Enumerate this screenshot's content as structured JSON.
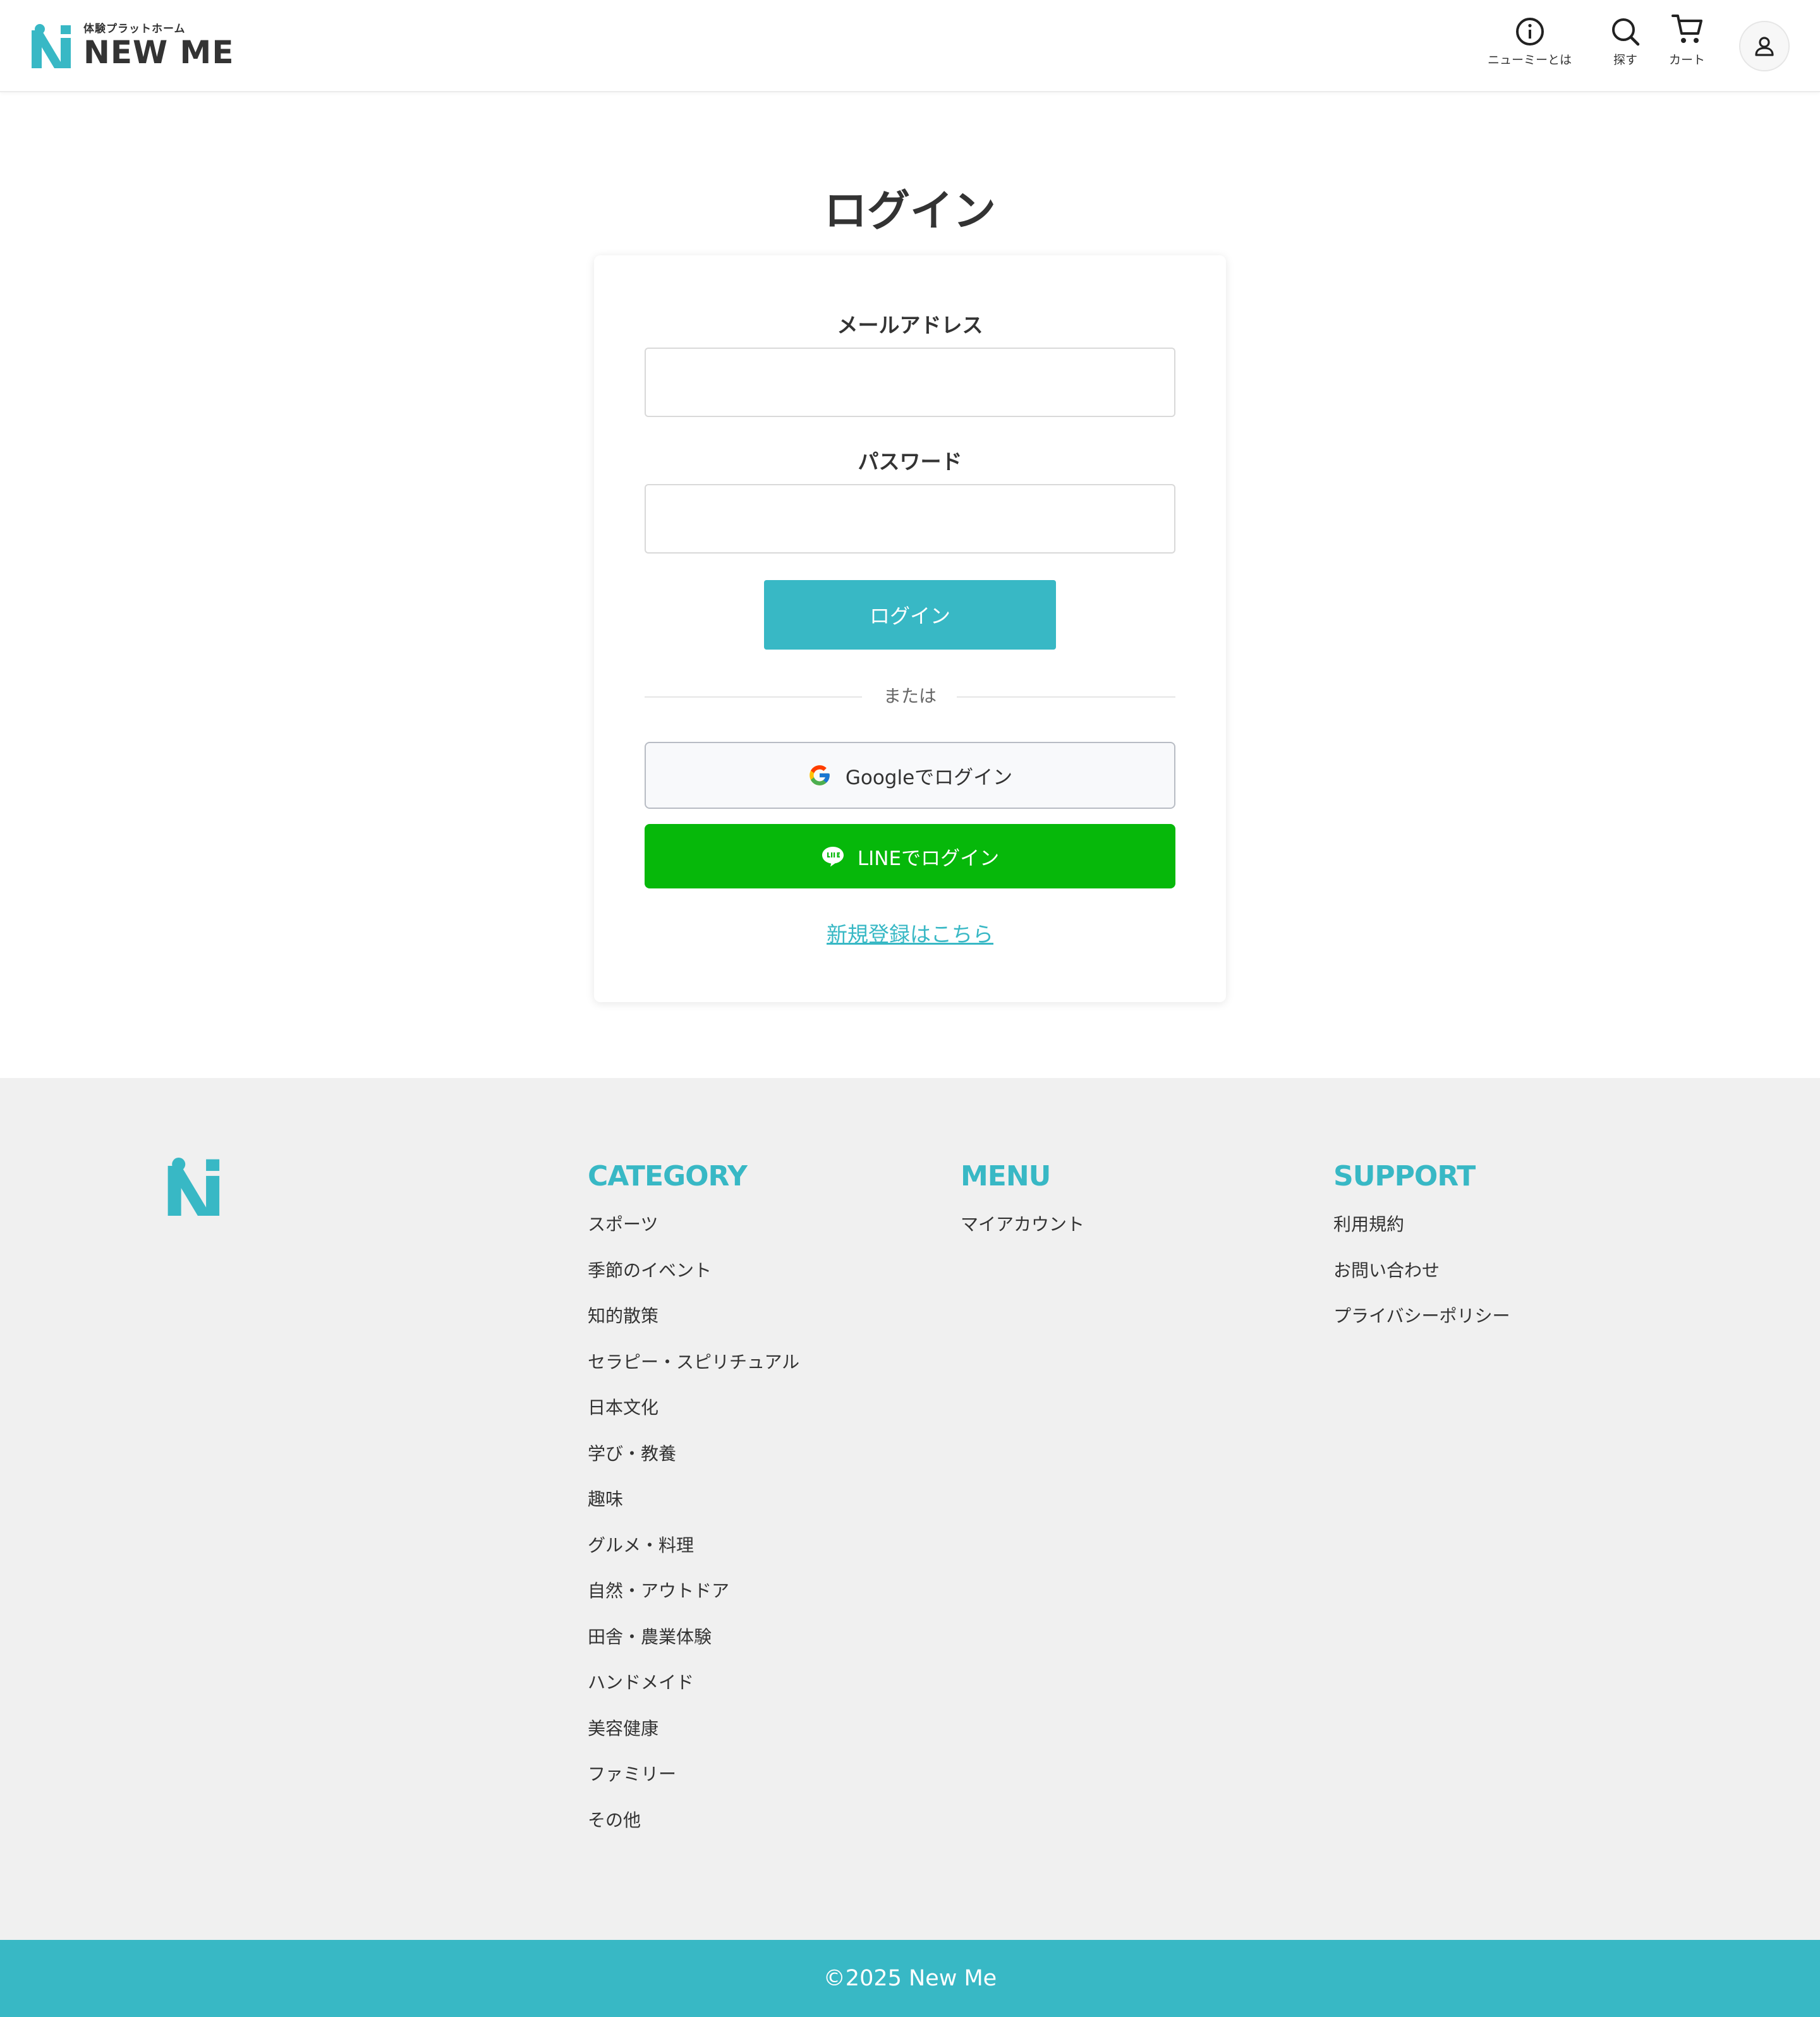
{
  "header": {
    "logo_subtitle": "体験プラットホーム",
    "logo_title": "NEW ME",
    "nav": [
      {
        "label": "ニューミーとは",
        "icon": "info-icon"
      },
      {
        "label": "探す",
        "icon": "search-icon"
      },
      {
        "label": "カート",
        "icon": "cart-icon"
      }
    ],
    "account_icon": "user-icon"
  },
  "login": {
    "title": "ログイン",
    "email_label": "メールアドレス",
    "email_value": "",
    "password_label": "パスワード",
    "password_value": "",
    "submit_label": "ログイン",
    "divider_text": "または",
    "google_label": "Googleでログイン",
    "line_label": "LINEでログイン",
    "register_link": "新規登録はこちら"
  },
  "footer": {
    "category": {
      "title": "CATEGORY",
      "items": [
        "スポーツ",
        "季節のイベント",
        "知的散策",
        "セラピー・スピリチュアル",
        "日本文化",
        "学び・教養",
        "趣味",
        "グルメ・料理",
        "自然・アウトドア",
        "田舎・農業体験",
        "ハンドメイド",
        "美容健康",
        "ファミリー",
        "その他"
      ]
    },
    "menu": {
      "title": "MENU",
      "items": [
        "マイアカウント"
      ]
    },
    "support": {
      "title": "SUPPORT",
      "items": [
        "利用規約",
        "お問い合わせ",
        "プライバシーポリシー"
      ]
    },
    "copyright": "©2025 New Me"
  },
  "colors": {
    "brand": "#38b8c5",
    "line_green": "#06b80a",
    "footer_bg": "#f0f0f0"
  }
}
